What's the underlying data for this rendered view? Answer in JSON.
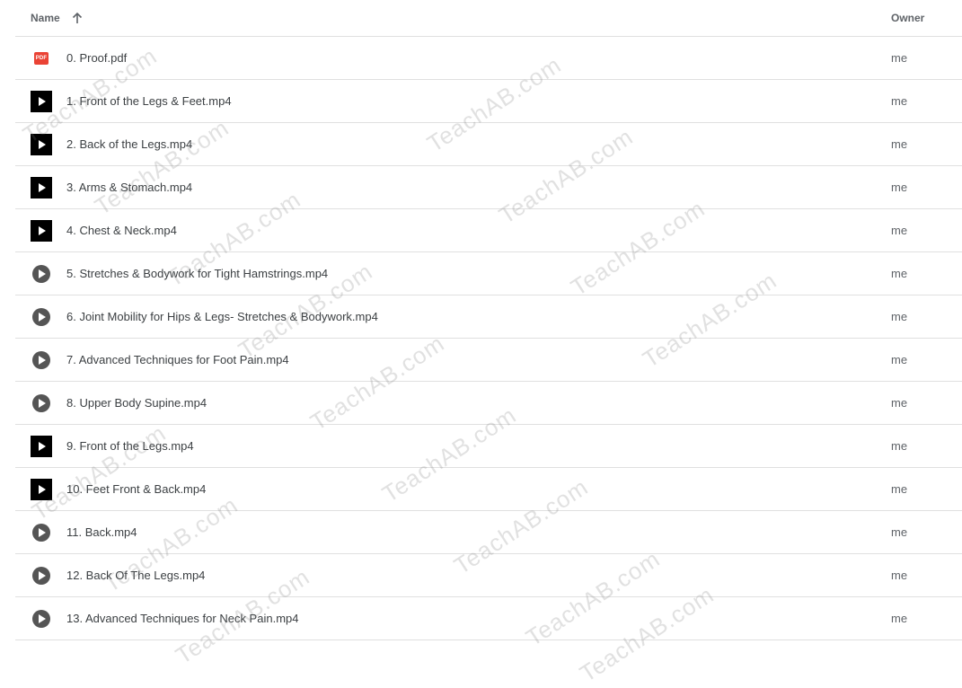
{
  "header": {
    "name_label": "Name",
    "owner_label": "Owner",
    "sort_icon": "arrow-up-icon"
  },
  "files": [
    {
      "name": "0. Proof.pdf",
      "owner": "me",
      "icon": "pdf-icon"
    },
    {
      "name": "1. Front of the Legs & Feet.mp4",
      "owner": "me",
      "icon": "video-play-icon"
    },
    {
      "name": "2. Back of the Legs.mp4",
      "owner": "me",
      "icon": "video-play-icon"
    },
    {
      "name": "3. Arms & Stomach.mp4",
      "owner": "me",
      "icon": "video-play-icon"
    },
    {
      "name": "4. Chest & Neck.mp4",
      "owner": "me",
      "icon": "video-play-icon"
    },
    {
      "name": "5. Stretches & Bodywork for Tight Hamstrings.mp4",
      "owner": "me",
      "icon": "video-thumbnail-icon"
    },
    {
      "name": "6. Joint Mobility for Hips & Legs- Stretches & Bodywork.mp4",
      "owner": "me",
      "icon": "video-thumbnail-icon"
    },
    {
      "name": "7. Advanced Techniques for Foot Pain.mp4",
      "owner": "me",
      "icon": "video-thumbnail-icon"
    },
    {
      "name": "8. Upper Body Supine.mp4",
      "owner": "me",
      "icon": "video-thumbnail-icon"
    },
    {
      "name": "9. Front of the Legs.mp4",
      "owner": "me",
      "icon": "video-play-icon"
    },
    {
      "name": "10. Feet Front & Back.mp4",
      "owner": "me",
      "icon": "video-play-icon"
    },
    {
      "name": "11. Back.mp4",
      "owner": "me",
      "icon": "video-thumbnail-icon"
    },
    {
      "name": "12. Back Of The Legs.mp4",
      "owner": "me",
      "icon": "video-thumbnail-icon"
    },
    {
      "name": "13. Advanced Techniques for Neck Pain.mp4",
      "owner": "me",
      "icon": "video-thumbnail-icon"
    }
  ],
  "watermark": "TeachAB.com",
  "colors": {
    "pdf_red": "#ea4335",
    "divider": "#e0e0e0",
    "text": "#3c4043"
  }
}
